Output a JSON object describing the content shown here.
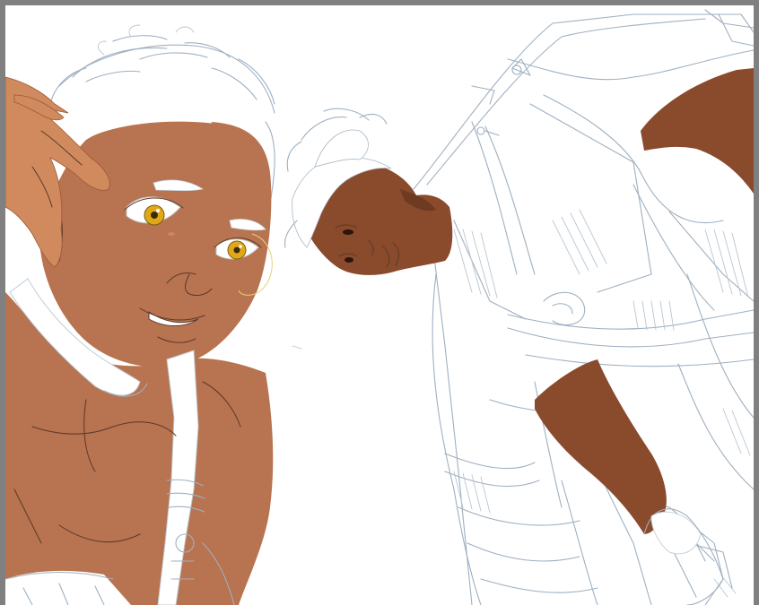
{
  "canvas": {
    "background": "#ffffff",
    "frame_color": "#808080",
    "skin_light": "#b87350",
    "skin_dark": "#8a4a2c",
    "hand_color": "#d08a5e",
    "eye_color": "#e0a818",
    "sketch_color": "#9fb0c0"
  }
}
